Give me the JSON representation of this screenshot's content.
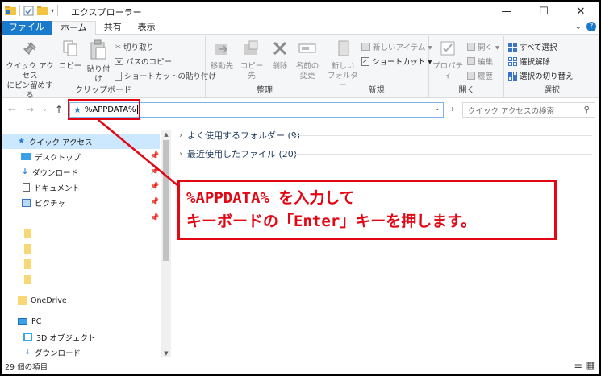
{
  "window": {
    "title": "エクスプローラー",
    "controls": {
      "minimize": "—",
      "maximize": "☐",
      "close": "✕"
    }
  },
  "ribbon_tabs": [
    "ファイル",
    "ホーム",
    "共有",
    "表示"
  ],
  "ribbon": {
    "clipboard": {
      "pin_label": "クイック アクセス\nにピン留めする",
      "copy_label": "コピー",
      "paste_label": "貼り付け",
      "cut_label": "切り取り",
      "copy_path_label": "パスのコピー",
      "paste_shortcut_label": "ショートカットの貼り付け",
      "group_label": "クリップボード"
    },
    "organize": {
      "move_label": "移動先",
      "copy_to_label": "コピー先",
      "delete_label": "削除",
      "rename_label": "名前の\n変更",
      "group_label": "整理"
    },
    "new": {
      "new_folder_label": "新しい\nフォルダー",
      "new_item_label": "新しいアイテム ▾",
      "shortcut_label": "ショートカット ▾",
      "group_label": "新規"
    },
    "open": {
      "properties_label": "プロパティ",
      "open_label": "開く ▾",
      "edit_label": "編集",
      "history_label": "履歴",
      "group_label": "開く"
    },
    "select": {
      "select_all_label": "すべて選択",
      "select_none_label": "選択解除",
      "invert_label": "選択の切り替え",
      "group_label": "選択"
    }
  },
  "address": {
    "value": "%APPDATA%",
    "search_placeholder": "クイック アクセスの検索"
  },
  "nav": {
    "quick_access": "クイック アクセス",
    "desktop": "デスクトップ",
    "downloads": "ダウンロード",
    "documents": "ドキュメント",
    "pictures": "ピクチャ",
    "onedrive": "OneDrive",
    "pc": "PC",
    "objects3d": "3D オブジェクト",
    "downloads2": "ダウンロード"
  },
  "content": {
    "frequent": "よく使用するフォルダー (9)",
    "recent": "最近使用したファイル (20)"
  },
  "callout": {
    "line1": "%APPDATA% を入力して",
    "line2": "キーボードの「Enter」キーを押します。"
  },
  "status": {
    "item_count": "29 個の項目"
  },
  "colors": {
    "accent": "#1979ca",
    "highlight": "#e30613",
    "selected": "#cce8ff"
  }
}
